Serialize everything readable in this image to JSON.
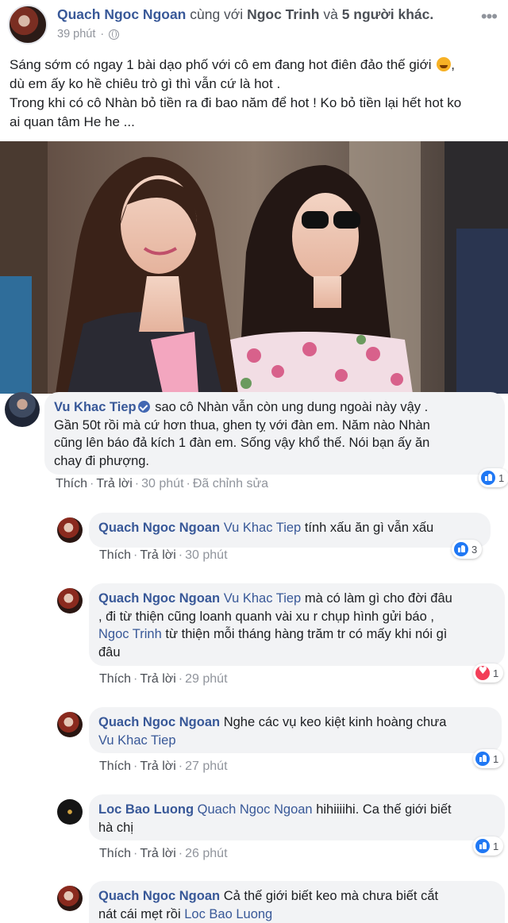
{
  "post": {
    "author": "Quach Ngoc Ngoan",
    "with_text": "cùng với",
    "tagged": "Ngoc Trinh",
    "others_text": "và",
    "others_count": "5 người khác.",
    "time": "39 phút",
    "privacy_icon": "globe-icon",
    "more_icon": "more-options-icon",
    "text_line_1": "Sáng sớm có ngay 1 bài dạo phố với cô em đang hot điên đảo thế giới",
    "text_line_1_emoji": "devil-emoji",
    "text_line_1_end": ",",
    "text_line_2": "dù em ấy ko hề chiêu trò gì thì vẫn cứ là hot .",
    "text_line_3": "Trong khi có cô Nhàn bỏ tiền ra đi bao năm để hot ! Ko bỏ tiền lại hết hot ko",
    "text_line_4": "ai quan tâm He he ..."
  },
  "actions": {
    "like": "Thích",
    "reply": "Trả lời",
    "dot": "·"
  },
  "comments": [
    {
      "author": "Vu Khac Tiep",
      "verified": true,
      "line_1": "sao cô Nhàn vẫn còn ung dung ngoài này vậy .",
      "line_2": "Gần 50t rồi mà cứ hơn thua, ghen tỵ với đàn em. Năm nào Nhàn",
      "line_3": "cũng lên báo đả kích 1 đàn em. Sống vậy khổ thế. Nói bạn ấy ăn",
      "line_4": "chay đi phượng.",
      "time": "30 phút",
      "edited": "Đã chỉnh sửa",
      "reaction_count": "1"
    },
    {
      "author": "Quach Ngoc Ngoan",
      "mention": "Vu Khac Tiep",
      "line_1": "tính xấu ăn gì vẫn xấu",
      "time": "30 phút",
      "reaction_count": "3"
    },
    {
      "author": "Quach Ngoc Ngoan",
      "mention": "Vu Khac Tiep",
      "line_1": "mà có làm gì cho đời đâu",
      "line_2": ", đi từ thiện cũng loanh quanh vài xu r chụp hình gửi báo ,",
      "mention_2": "Ngoc Trinh",
      "line_3": "từ thiện mỗi tháng hàng trăm tr có mấy khi nói gì",
      "line_4": "đâu",
      "time": "29 phút",
      "reaction_count": "1"
    },
    {
      "author": "Quach Ngoc Ngoan",
      "line_1": "Nghe các vụ keo kiệt kinh hoàng chưa",
      "mention": "Vu Khac Tiep",
      "time": "27 phút",
      "reaction_count": "1"
    },
    {
      "author": "Loc Bao Luong",
      "mention": "Quach Ngoc Ngoan",
      "line_1": "hihiiiihi. Ca thế giới biết",
      "line_2": "hà chị",
      "time": "26 phút",
      "reaction_count": "1"
    },
    {
      "author": "Quach Ngoc Ngoan",
      "line_1": "Cả thế giới biết keo mà chưa biết cắt",
      "line_2": "nát cái mẹt rồi",
      "mention": "Loc Bao Luong"
    }
  ],
  "colors": {
    "link": "#385898",
    "bubble": "#f2f3f5",
    "meta": "#90949c",
    "like": "#2078f4",
    "love": "#f33e58"
  }
}
